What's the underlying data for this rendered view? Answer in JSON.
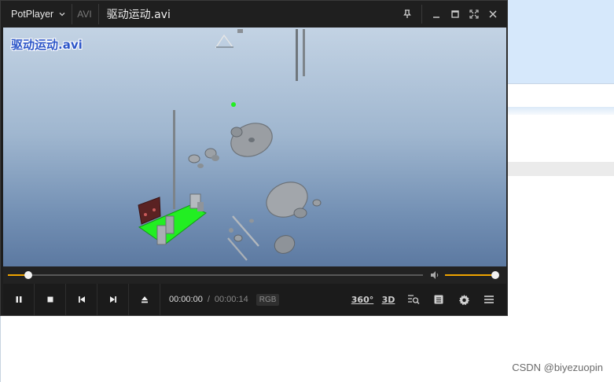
{
  "titlebar": {
    "app_name": "PotPlayer",
    "format": "AVI",
    "file_name": "驱动运动.avi"
  },
  "video": {
    "osd_title": "驱动运动.avi"
  },
  "playback": {
    "position": "00:00:00",
    "separator": "/",
    "duration": "00:00:14",
    "color_space": "RGB",
    "seek_fraction": 0.05,
    "volume_fraction": 1.0
  },
  "toolbar": {
    "vr_label": "360°",
    "stereo_label": "3D"
  },
  "icons": [
    "chevron-down-icon",
    "pin-icon",
    "minimize-icon",
    "maximize-icon",
    "fullscreen-icon",
    "close-icon",
    "pause-icon",
    "stop-icon",
    "previous-icon",
    "next-icon",
    "eject-icon",
    "speaker-icon",
    "search-list-icon",
    "playlist-icon",
    "gear-icon",
    "menu-icon"
  ],
  "colors": {
    "accent": "#f0a400",
    "osd_text": "#2d56c8",
    "green_part": "#22ee22"
  },
  "watermark": "CSDN @biyezuopin"
}
